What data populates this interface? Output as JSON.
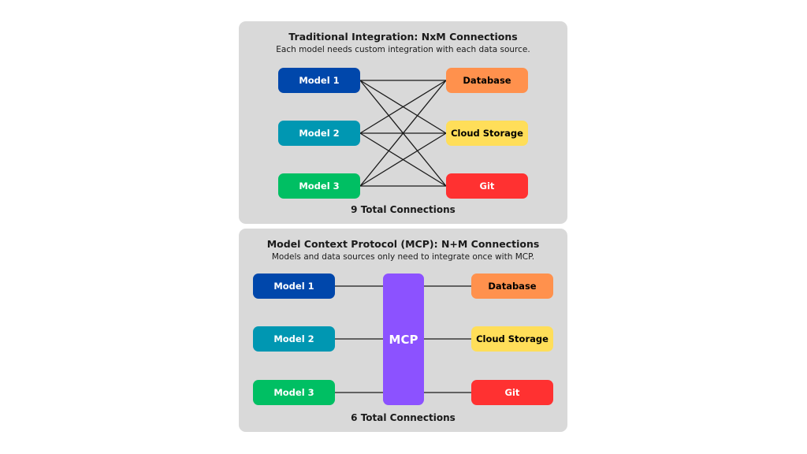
{
  "traditional": {
    "title": "Traditional Integration: NxM Connections",
    "subtitle": "Each model needs custom integration with each data source.",
    "footer": "9 Total Connections",
    "models": [
      {
        "label": "Model 1",
        "color": "#0047ab",
        "text_color": "#ffffff"
      },
      {
        "label": "Model 2",
        "color": "#0097b2",
        "text_color": "#ffffff"
      },
      {
        "label": "Model 3",
        "color": "#00bf63",
        "text_color": "#ffffff"
      }
    ],
    "sources": [
      {
        "label": "Database",
        "color": "#ff914d",
        "text_color": "#000000"
      },
      {
        "label": "Cloud Storage",
        "color": "#ffde59",
        "text_color": "#000000"
      },
      {
        "label": "Git",
        "color": "#ff3131",
        "text_color": "#ffffff"
      }
    ]
  },
  "mcp": {
    "title": "Model Context Protocol (MCP): N+M Connections",
    "subtitle": "Models and data sources only need to integrate once with MCP.",
    "footer": "6 Total Connections",
    "hub_label": "MCP",
    "hub_color": "#8c52ff",
    "models": [
      {
        "label": "Model 1",
        "color": "#0047ab",
        "text_color": "#ffffff"
      },
      {
        "label": "Model 2",
        "color": "#0097b2",
        "text_color": "#ffffff"
      },
      {
        "label": "Model 3",
        "color": "#00bf63",
        "text_color": "#ffffff"
      }
    ],
    "sources": [
      {
        "label": "Database",
        "color": "#ff914d",
        "text_color": "#000000"
      },
      {
        "label": "Cloud Storage",
        "color": "#ffde59",
        "text_color": "#000000"
      },
      {
        "label": "Git",
        "color": "#ff3131",
        "text_color": "#ffffff"
      }
    ]
  }
}
